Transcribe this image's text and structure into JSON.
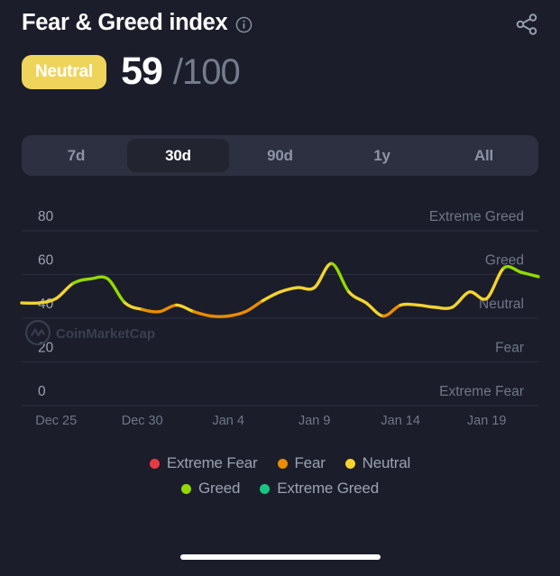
{
  "header": {
    "title": "Fear & Greed index",
    "info_icon": "info-circle-icon",
    "share_icon": "share-icon"
  },
  "score": {
    "badge_label": "Neutral",
    "badge_color": "#efd45c",
    "value": "59",
    "max": "/100"
  },
  "tabs": {
    "items": [
      {
        "label": "7d",
        "active": false
      },
      {
        "label": "30d",
        "active": true
      },
      {
        "label": "90d",
        "active": false
      },
      {
        "label": "1y",
        "active": false
      },
      {
        "label": "All",
        "active": false
      }
    ]
  },
  "watermark": "CoinMarketCap",
  "legend": {
    "rows": [
      [
        {
          "label": "Extreme Fear",
          "color": "#ea3943"
        },
        {
          "label": "Fear",
          "color": "#ea8c00"
        },
        {
          "label": "Neutral",
          "color": "#f3d42f"
        }
      ],
      [
        {
          "label": "Greed",
          "color": "#93d900"
        },
        {
          "label": "Extreme Greed",
          "color": "#16c784"
        }
      ]
    ]
  },
  "chart_data": {
    "type": "line",
    "title": "Fear & Greed index",
    "xlabel": "",
    "ylabel": "",
    "ylim": [
      0,
      88
    ],
    "yticks": [
      80,
      60,
      40,
      20,
      0
    ],
    "grid": true,
    "legend_position": "bottom",
    "zone_labels": [
      {
        "label": "Extreme Greed",
        "y": 80
      },
      {
        "label": "Greed",
        "y": 60
      },
      {
        "label": "Neutral",
        "y": 40
      },
      {
        "label": "Fear",
        "y": 20
      },
      {
        "label": "Extreme Fear",
        "y": 0
      }
    ],
    "xticks": [
      "Dec 25",
      "Dec 30",
      "Jan 4",
      "Jan 9",
      "Jan 14",
      "Jan 19"
    ],
    "x": [
      "Dec 23",
      "Dec 24",
      "Dec 25",
      "Dec 26",
      "Dec 27",
      "Dec 28",
      "Dec 29",
      "Dec 30",
      "Dec 31",
      "Jan 1",
      "Jan 2",
      "Jan 3",
      "Jan 4",
      "Jan 5",
      "Jan 6",
      "Jan 7",
      "Jan 8",
      "Jan 9",
      "Jan 10",
      "Jan 11",
      "Jan 12",
      "Jan 13",
      "Jan 14",
      "Jan 15",
      "Jan 16",
      "Jan 17",
      "Jan 18",
      "Jan 19",
      "Jan 20",
      "Jan 21",
      "Jan 22"
    ],
    "values": [
      47,
      47,
      49,
      56,
      58,
      58,
      47,
      44,
      43,
      46,
      43,
      41,
      41,
      43,
      48,
      52,
      54,
      54,
      65,
      52,
      47,
      41,
      46,
      46,
      45,
      45,
      52,
      49,
      63,
      61,
      59
    ],
    "series": [
      {
        "name": "Fear & Greed index",
        "values": [
          47,
          47,
          49,
          56,
          58,
          58,
          47,
          44,
          43,
          46,
          43,
          41,
          41,
          43,
          48,
          52,
          54,
          54,
          65,
          52,
          47,
          41,
          46,
          46,
          45,
          45,
          52,
          49,
          63,
          61,
          59
        ]
      }
    ],
    "color_bands": [
      {
        "name": "Extreme Fear",
        "range": [
          0,
          24
        ],
        "color": "#ea3943"
      },
      {
        "name": "Fear",
        "range": [
          25,
          44
        ],
        "color": "#ea8c00"
      },
      {
        "name": "Neutral",
        "range": [
          45,
          54
        ],
        "color": "#f3d42f"
      },
      {
        "name": "Greed",
        "range": [
          55,
          74
        ],
        "color": "#93d900"
      },
      {
        "name": "Extreme Greed",
        "range": [
          75,
          100
        ],
        "color": "#16c784"
      }
    ]
  }
}
